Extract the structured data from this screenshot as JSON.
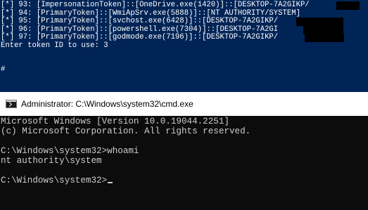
{
  "powershell": {
    "lines": [
      "[*] 93: [ImpersonationToken]::[OneDrive.exe(1420)]::[DESKTOP-7A2GIKP/",
      "[*] 94: [PrimaryToken]::[WmiApSrv.exe(5888)]::[NT AUTHORITY/SYSTEM]",
      "[*] 95: [PrimaryToken]::[svchost.exe(6428)]::[DESKTOP-7A2GIKP/",
      "[*] 96: [PrimaryToken]::[powershell.exe(7304)]::[DESKTOP-7A2GI",
      "[*] 97: [PrimaryToken]::[godmode.exe(7196)]::[DESKTOP-7A2GIKP/",
      "Enter token ID to use: 3",
      "",
      "",
      "#"
    ]
  },
  "cmd_window": {
    "title": "Administrator: C:\\Windows\\system32\\cmd.exe",
    "icon": "cmd-icon",
    "lines": [
      "Microsoft Windows [Version 10.0.19044.2251]",
      "(c) Microsoft Corporation. All rights reserved.",
      "",
      "C:\\Windows\\system32>whoami",
      "nt authority\\system",
      "",
      "C:\\Windows\\system32>"
    ]
  },
  "colors": {
    "powershell_bg": "#012456",
    "cmd_bg": "#0c0c0c",
    "cmd_text": "#cccccc",
    "titlebar_bg": "#ffffff"
  }
}
